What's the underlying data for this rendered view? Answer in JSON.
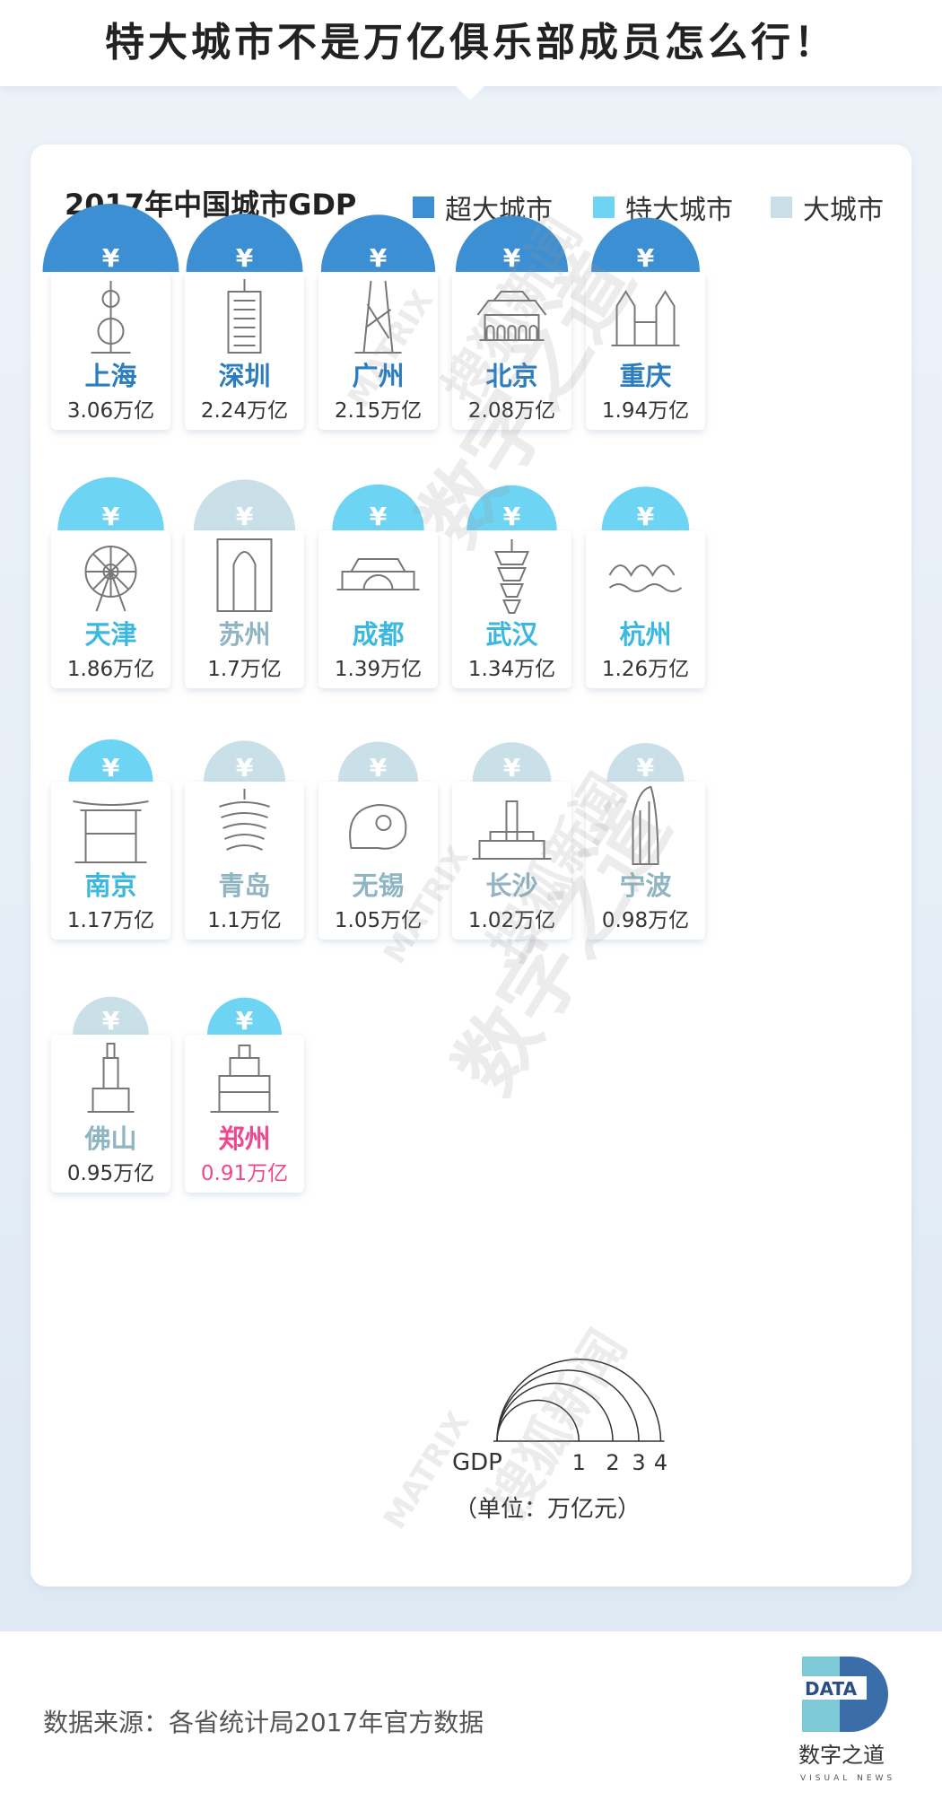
{
  "header": {
    "title": "特大城市不是万亿俱乐部成员怎么行！"
  },
  "chart_data": {
    "type": "bar",
    "title": "2017年中国城市GDP",
    "unit": "万亿",
    "legend": [
      {
        "name": "超大城市",
        "color": "#3d8fd3"
      },
      {
        "name": "特大城市",
        "color": "#6ed4f3"
      },
      {
        "name": "大城市",
        "color": "#c9e0e8"
      }
    ],
    "categories": [
      "上海",
      "深圳",
      "广州",
      "北京",
      "重庆",
      "天津",
      "苏州",
      "成都",
      "武汉",
      "杭州",
      "南京",
      "青岛",
      "无锡",
      "长沙",
      "宁波",
      "佛山",
      "郑州"
    ],
    "values": [
      3.06,
      2.24,
      2.15,
      2.08,
      1.94,
      1.86,
      1.7,
      1.39,
      1.34,
      1.26,
      1.17,
      1.1,
      1.05,
      1.02,
      0.98,
      0.95,
      0.91
    ],
    "value_labels": [
      "3.06万亿",
      "2.24万亿",
      "2.15万亿",
      "2.08万亿",
      "1.94万亿",
      "1.86万亿",
      "1.7万亿",
      "1.39万亿",
      "1.34万亿",
      "1.26万亿",
      "1.17万亿",
      "1.1万亿",
      "1.05万亿",
      "1.02万亿",
      "0.98万亿",
      "0.95万亿",
      "0.91万亿"
    ],
    "tiers": [
      "超大城市",
      "超大城市",
      "超大城市",
      "超大城市",
      "超大城市",
      "特大城市",
      "大城市",
      "特大城市",
      "特大城市",
      "特大城市",
      "特大城市",
      "大城市",
      "大城市",
      "大城市",
      "大城市",
      "大城市",
      "特大城市"
    ],
    "highlight": "郑州",
    "highlight_color": "#f0478c",
    "scale_legend": {
      "label": "GDP",
      "ticks": [
        1,
        2,
        3,
        4
      ],
      "unit_note": "（单位：万亿元）"
    }
  },
  "footer": {
    "source": "数据来源：各省统计局2017年官方数据",
    "logo_text": "DATA",
    "brand": "数字之道",
    "brand_sub": "VISUAL NEWS"
  },
  "watermark": {
    "matrix": "MATRIX",
    "brand_cn": "搜狐新闻",
    "brand_big": "数字之道"
  }
}
